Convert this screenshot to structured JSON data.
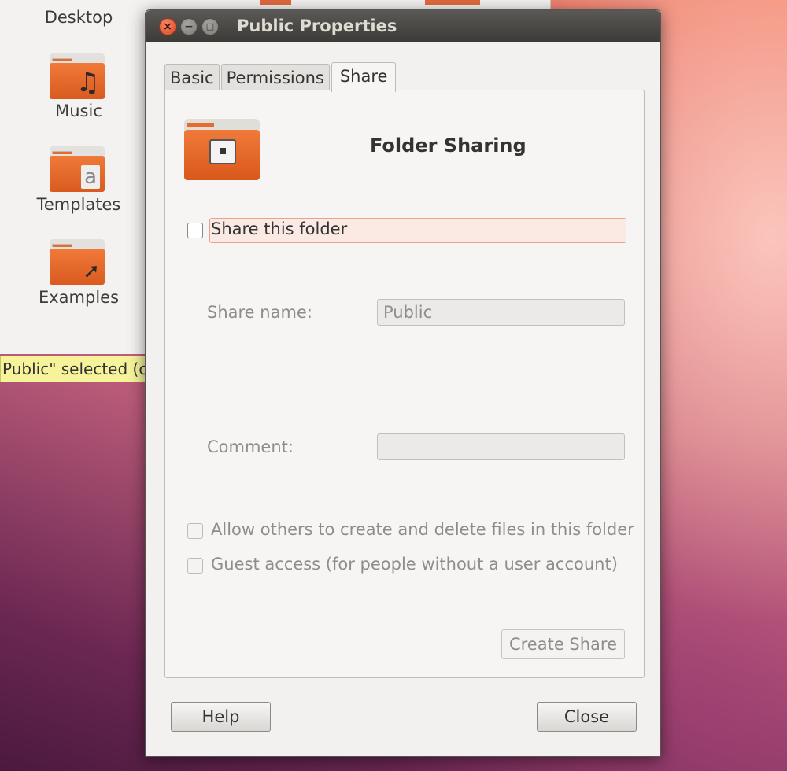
{
  "file_manager": {
    "items": [
      {
        "label": "Desktop"
      },
      {
        "label": "Music",
        "icon": "music-note-icon"
      },
      {
        "label": "Templates",
        "icon": "template-icon"
      },
      {
        "label": "Examples",
        "icon": "link-arrow-icon"
      }
    ],
    "status": "Public\" selected (c"
  },
  "dialog": {
    "title": "Public Properties",
    "window_buttons": [
      "close",
      "minimize",
      "maximize"
    ],
    "tabs": [
      {
        "label": "Basic",
        "active": false
      },
      {
        "label": "Permissions",
        "active": false
      },
      {
        "label": "Share",
        "active": true
      }
    ],
    "share": {
      "heading": "Folder Sharing",
      "share_checkbox_label": "Share this folder",
      "share_checked": false,
      "share_name_label": "Share name:",
      "share_name_value": "Public",
      "comment_label": "Comment:",
      "comment_value": "",
      "allow_others_label": "Allow others to create and delete files in this folder",
      "guest_label": "Guest access (for people without a user account)",
      "create_button": "Create Share"
    },
    "help_button": "Help",
    "close_button": "Close"
  },
  "colors": {
    "accent": "#e96b2b",
    "titlebar": "#3c3b37",
    "focus_highlight": "#fbe9e4"
  }
}
